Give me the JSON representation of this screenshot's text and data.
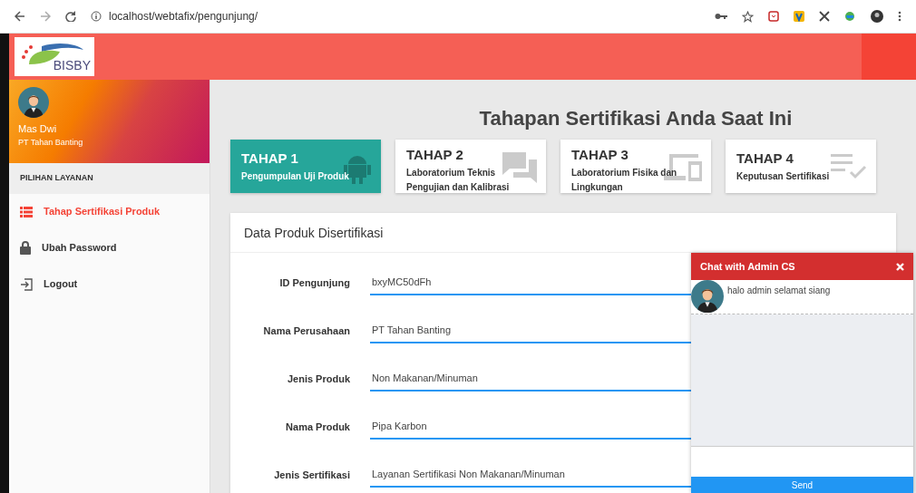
{
  "browser": {
    "url": "localhost/webtafix/pengunjung/"
  },
  "header": {
    "logo_text": "BISBY"
  },
  "profile": {
    "name": "Mas Dwi",
    "company": "PT Tahan Banting"
  },
  "sidebar": {
    "heading": "PILIHAN LAYANAN",
    "items": [
      {
        "label": "Tahap Sertifikasi Produk",
        "kind": "list",
        "selected": true
      },
      {
        "label": "Ubah Password",
        "kind": "lock",
        "selected": false
      },
      {
        "label": "Logout",
        "kind": "logout",
        "selected": false
      }
    ]
  },
  "page_title": "Tahapan Sertifikasi Anda Saat Ini",
  "steps": [
    {
      "title": "TAHAP 1",
      "subtitle": "Pengumpulan Uji Produk",
      "kind": "android",
      "selected": true
    },
    {
      "title": "TAHAP 2",
      "subtitle": "Laboratorium Teknis Pengujian dan Kalibrasi",
      "kind": "chat",
      "selected": false
    },
    {
      "title": "TAHAP 3",
      "subtitle": "Laboratorium Fisika dan Lingkungan",
      "kind": "devices",
      "selected": false
    },
    {
      "title": "TAHAP 4",
      "subtitle": "Keputusan Sertifikasi",
      "kind": "checklist",
      "selected": false
    }
  ],
  "form": {
    "title": "Data Produk Disertifikasi",
    "fields": [
      {
        "label": "ID Pengunjung",
        "value": "bxyMC50dFh"
      },
      {
        "label": "Nama Perusahaan",
        "value": "PT Tahan Banting"
      },
      {
        "label": "Jenis Produk",
        "value": "Non Makanan/Minuman"
      },
      {
        "label": "Nama Produk",
        "value": "Pipa Karbon"
      },
      {
        "label": "Jenis Sertifikasi",
        "value": "Layanan Sertifikasi Non Makanan/Minuman"
      }
    ]
  },
  "chat": {
    "title": "Chat with Admin CS",
    "messages": [
      {
        "text": "halo admin selamat siang"
      }
    ],
    "send_label": "Send"
  }
}
